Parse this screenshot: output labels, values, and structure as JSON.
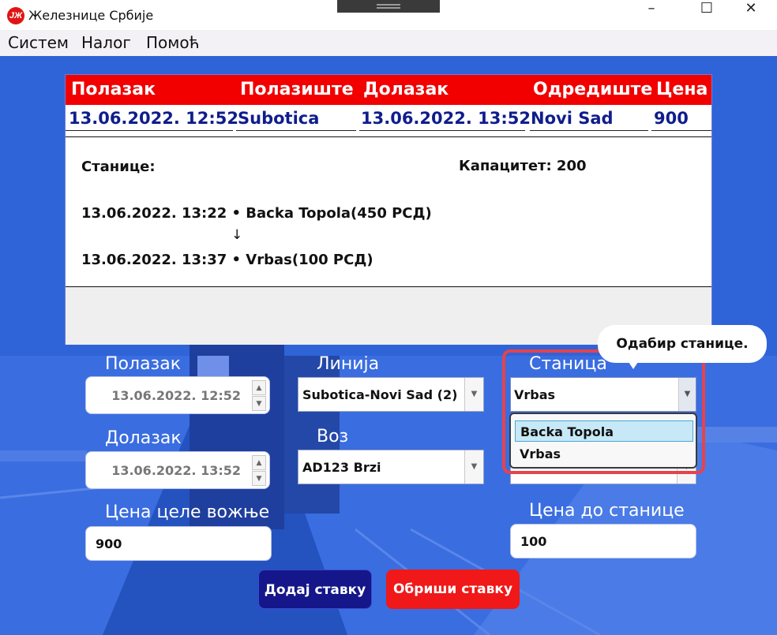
{
  "window": {
    "title": "Железнице Србије",
    "logo_text": "ЈЖ",
    "icons": {
      "logo": "srbija-rail-logo-icon",
      "minimize": "minimize-icon",
      "maximize": "maximize-icon",
      "close": "close-icon"
    }
  },
  "menu": [
    "Систем",
    "Налог",
    "Помоћ"
  ],
  "table": {
    "headers": [
      "Полазак",
      "Полазиште",
      "Долазак",
      "Одредиште",
      "Цена"
    ],
    "row": [
      "13.06.2022. 12:52",
      "Subotica",
      "13.06.2022. 13:52",
      "Novi Sad",
      "900"
    ]
  },
  "details": {
    "stations_label": "Станице:",
    "capacity": "Капацитет: 200",
    "stop1": "13.06.2022. 13:22 • Backa Topola(450 РСД)",
    "arrow": "↓",
    "stop2": "13.06.2022. 13:37 • Vrbas(100 РСД)"
  },
  "form": {
    "departure_label": "Полазак",
    "departure_value": "13.06.2022. 12:52",
    "arrival_label": "Долазак",
    "arrival_value": "13.06.2022. 13:52",
    "line_label": "Линија",
    "line_value": "Subotica-Novi Sad (2)",
    "train_label": "Воз",
    "train_value": "AD123 Brzi",
    "station_label": "Станица",
    "station_value": "Vrbas",
    "station_options": [
      "Backa Topola",
      "Vrbas"
    ],
    "full_price_label": "Цена целе вожње",
    "full_price_value": "900",
    "station_price_label": "Цена до станице",
    "station_price_value": "100"
  },
  "buttons": {
    "add": "Додај ставку",
    "delete": "Обриши ставку"
  },
  "callout": "Одабир станице.",
  "colors": {
    "background": "#2f63d8",
    "header": "#f20000",
    "add_button": "#14168a",
    "delete_button": "#f01818",
    "highlight": "#e5434d"
  }
}
